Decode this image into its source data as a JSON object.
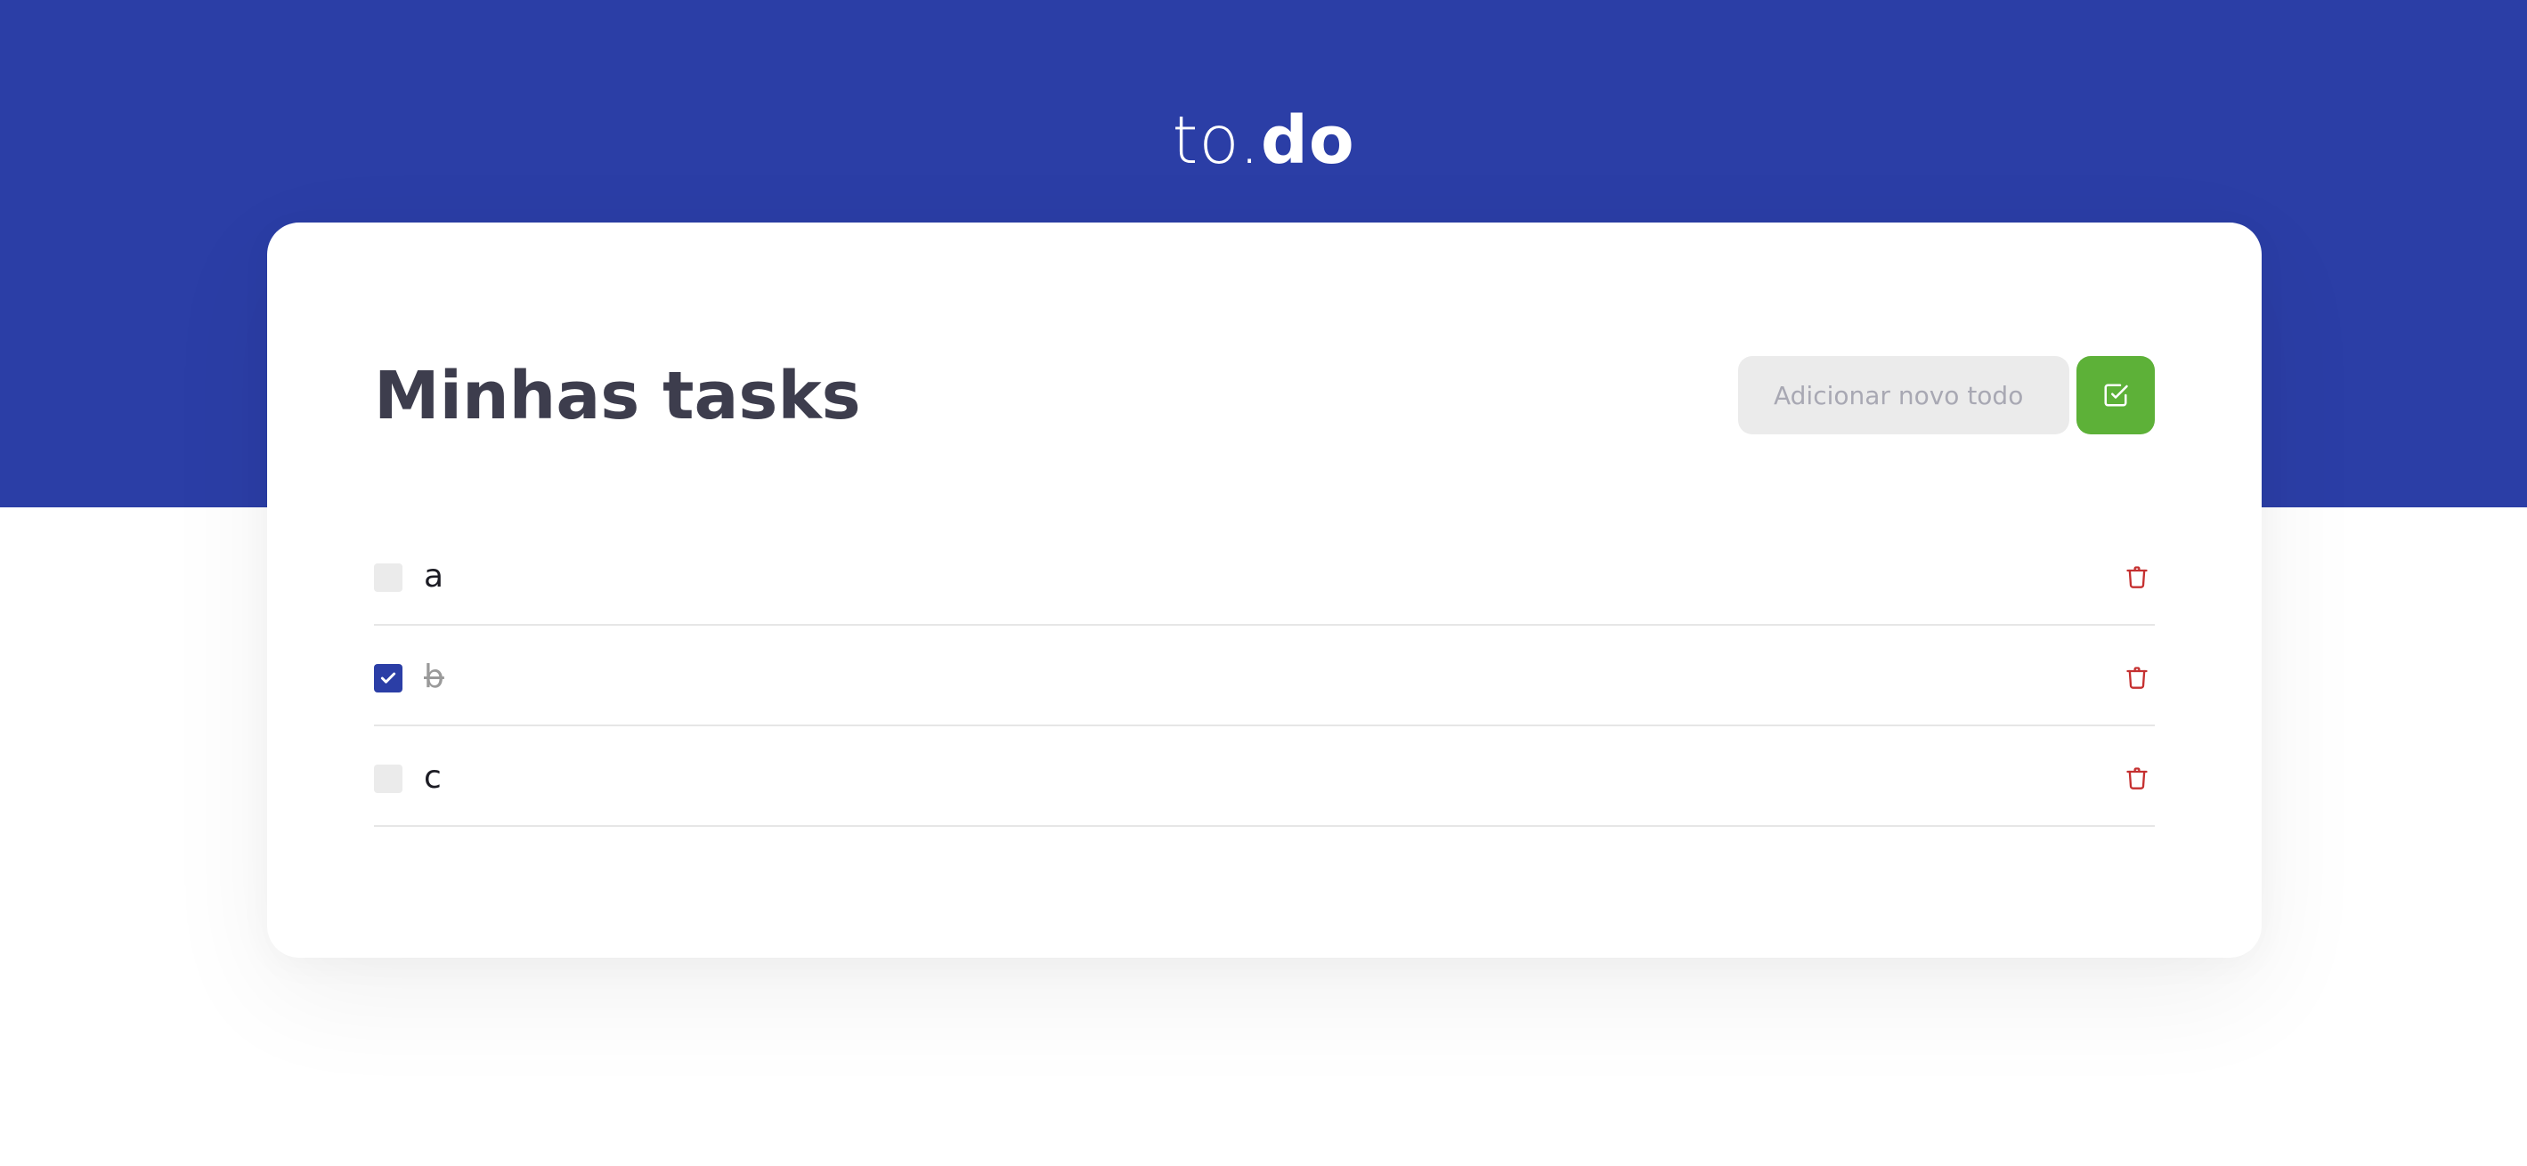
{
  "app": {
    "logo_light": "to.",
    "logo_bold": "do"
  },
  "main": {
    "title": "Minhas tasks",
    "new_todo": {
      "placeholder": "Adicionar novo todo",
      "value": ""
    },
    "add_button_icon": "check-square-icon"
  },
  "tasks": [
    {
      "label": "a",
      "done": false
    },
    {
      "label": "b",
      "done": true
    },
    {
      "label": "c",
      "done": false
    }
  ],
  "icons": {
    "delete": "trash-icon",
    "checked": "checkmark-icon"
  },
  "colors": {
    "brand": "#2b3ea6",
    "success": "#5db138",
    "danger": "#c53030",
    "title": "#3d3d4d"
  }
}
